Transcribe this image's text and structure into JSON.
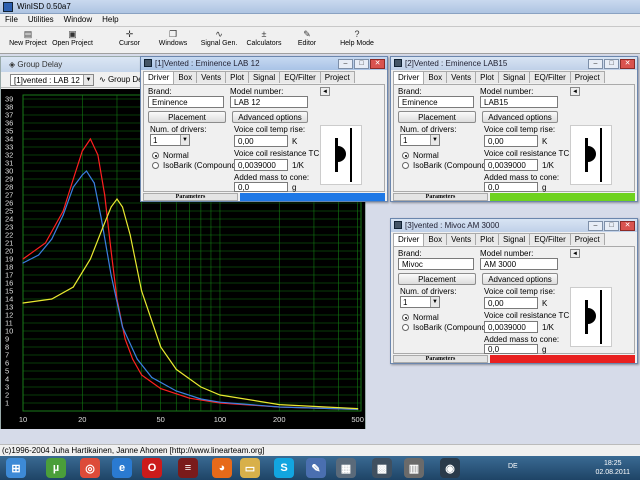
{
  "window": {
    "title": "WinISD 0.50a7"
  },
  "menu": [
    "File",
    "Utilities",
    "Window",
    "Help"
  ],
  "toolbar": [
    {
      "label": "New Project",
      "icon": "new-project-icon",
      "glyph": "▤"
    },
    {
      "label": "Open Project",
      "icon": "open-folder-icon",
      "glyph": "▣"
    },
    {
      "label": "Cursor",
      "icon": "cursor-icon",
      "glyph": "✛"
    },
    {
      "label": "Windows",
      "icon": "windows-icon",
      "glyph": "❐"
    },
    {
      "label": "Signal Gen.",
      "icon": "signal-generator-icon",
      "glyph": "∿"
    },
    {
      "label": "Calculators",
      "icon": "calculator-icon",
      "glyph": "±"
    },
    {
      "label": "Editor",
      "icon": "editor-icon",
      "glyph": "✎"
    },
    {
      "label": "Help Mode",
      "icon": "help-icon",
      "glyph": "?"
    }
  ],
  "group_delay": {
    "title": "Group Delay",
    "selector": "[1]vented : LAB 12",
    "button": "Group De"
  },
  "chart_data": {
    "type": "line",
    "title": "Group Delay",
    "x_scale": "log",
    "xlim": [
      10,
      520
    ],
    "ylim": [
      0,
      39.5
    ],
    "x_ticks": [
      10,
      20,
      50,
      100,
      200,
      500
    ],
    "y_ticks": [
      1,
      2,
      3,
      4,
      5,
      6,
      7,
      8,
      9,
      10,
      11,
      12,
      13,
      14,
      15,
      16,
      17,
      18,
      19,
      20,
      21,
      22,
      23,
      24,
      25,
      26,
      27,
      28,
      29,
      30,
      31,
      32,
      33,
      34,
      35,
      36,
      37,
      38,
      39
    ],
    "grid": true,
    "series": [
      {
        "color": "#ff2020",
        "x": [
          10,
          13,
          16,
          18,
          20,
          22,
          24,
          26,
          28,
          30,
          33,
          36,
          40,
          50,
          70,
          100,
          200,
          500
        ],
        "y": [
          19,
          21,
          25,
          29,
          32.5,
          34,
          32,
          27,
          20,
          14,
          9,
          6.5,
          4.5,
          2.8,
          1.6,
          1.0,
          0.5,
          0.2
        ]
      },
      {
        "color": "#3a7fe0",
        "x": [
          10,
          12,
          14,
          16,
          18,
          20,
          21,
          23,
          25,
          28,
          32,
          38,
          45,
          60,
          80,
          100,
          200,
          500
        ],
        "y": [
          18.5,
          19.5,
          21.5,
          24.5,
          28,
          29.5,
          30,
          28.5,
          24,
          17,
          10.5,
          6.5,
          4.2,
          2.5,
          1.5,
          1.1,
          0.5,
          0.2
        ]
      },
      {
        "color": "#e8e830",
        "x": [
          10,
          14,
          18,
          22,
          25,
          28,
          30,
          32,
          35,
          40,
          50,
          60,
          80,
          100,
          200,
          500
        ],
        "y": [
          13.5,
          14,
          15.5,
          19,
          22.5,
          25.5,
          26.5,
          25.5,
          22,
          15,
          8,
          5.2,
          3,
          2,
          0.8,
          0.3
        ]
      }
    ]
  },
  "windows": [
    {
      "title": "[1]Vented : Eminence  LAB 12",
      "tabs": [
        "Driver",
        "Box",
        "Vents",
        "Plot",
        "Signal",
        "EQ/Filter",
        "Project"
      ],
      "brand_label": "Brand:",
      "brand": "Eminence",
      "model_label": "Model number:",
      "model": "LAB 12",
      "placement": "Placement",
      "advanced": "Advanced options",
      "num_label": "Num. of drivers:",
      "num": "1",
      "normal": "Normal",
      "isobarik": "IsoBarik (Compound)",
      "vc_rise_label": "Voice coil temp rise:",
      "vc_rise": "0,00",
      "vc_rise_unit": "K",
      "vc_tc_label": "Voice coil resistance TC:",
      "vc_tc": "0,0039000",
      "vc_tc_unit": "1/K",
      "mass_label": "Added mass to cone:",
      "mass": "0,0",
      "mass_unit": "g",
      "params": "Parameters",
      "status_color": "#1e78e6"
    },
    {
      "title": "[2]Vented : Eminence LAB15",
      "tabs": [
        "Driver",
        "Box",
        "Vents",
        "Plot",
        "Signal",
        "EQ/Filter",
        "Project"
      ],
      "brand_label": "Brand:",
      "brand": "Eminence",
      "model_label": "Model number:",
      "model": "LAB15",
      "placement": "Placement",
      "advanced": "Advanced options",
      "num_label": "Num. of drivers:",
      "num": "1",
      "normal": "Normal",
      "isobarik": "IsoBarik (Compound)",
      "vc_rise_label": "Voice coil temp rise:",
      "vc_rise": "0,00",
      "vc_rise_unit": "K",
      "vc_tc_label": "Voice coil resistance TC:",
      "vc_tc": "0,0039000",
      "vc_tc_unit": "1/K",
      "mass_label": "Added mass to cone:",
      "mass": "0,0",
      "mass_unit": "g",
      "params": "Parameters",
      "status_color": "#6ed21e"
    },
    {
      "title": "[3]vented : Mivoc AM 3000",
      "tabs": [
        "Driver",
        "Box",
        "Vents",
        "Plot",
        "Signal",
        "EQ/Filter",
        "Project"
      ],
      "brand_label": "Brand:",
      "brand": "Mivoc",
      "model_label": "Model number:",
      "model": "AM 3000",
      "placement": "Placement",
      "advanced": "Advanced options",
      "num_label": "Num. of drivers:",
      "num": "1",
      "normal": "Normal",
      "isobarik": "IsoBarik (Compound)",
      "vc_rise_label": "Voice coil temp rise:",
      "vc_rise": "0,00",
      "vc_rise_unit": "K",
      "vc_tc_label": "Voice coil resistance TC:",
      "vc_tc": "0,0039000",
      "vc_tc_unit": "1/K",
      "mass_label": "Added mass to cone:",
      "mass": "0,0",
      "mass_unit": "g",
      "params": "Parameters",
      "status_color": "#e82020"
    }
  ],
  "statusbar": "(c)1996-2004 Juha Hartikainen, Janne Ahonen [http://www.linearteam.org]",
  "taskbar": {
    "lang": "DE",
    "time": "18:25",
    "date": "02.08.2011",
    "apps": [
      {
        "icon": "start-orb-icon",
        "color": "#3d8ad6",
        "glyph": "⊞"
      },
      {
        "icon": "utorrent-icon",
        "color": "#4a9e3a",
        "glyph": "µ"
      },
      {
        "icon": "chrome-icon",
        "color": "#dd4b39",
        "glyph": "◎"
      },
      {
        "icon": "internet-explorer-icon",
        "color": "#2a7ad1",
        "glyph": "e"
      },
      {
        "icon": "opera-icon",
        "color": "#cc1b1b",
        "glyph": "O"
      },
      {
        "icon": "media-app-icon",
        "color": "#7a1b1b",
        "glyph": "≡"
      },
      {
        "icon": "firefox-icon",
        "color": "#e76a1a",
        "glyph": "◕"
      },
      {
        "icon": "folder-icon",
        "color": "#d8b04a",
        "glyph": "▭"
      },
      {
        "icon": "skype-icon",
        "color": "#12a5e0",
        "glyph": "S"
      },
      {
        "icon": "paint-icon",
        "color": "#4a6fb0",
        "glyph": "✎"
      },
      {
        "icon": "winisd-icon",
        "color": "#5a6a7a",
        "glyph": "▦"
      },
      {
        "icon": "device-manager-icon",
        "color": "#405060",
        "glyph": "▩"
      },
      {
        "icon": "film-icon",
        "color": "#6a6a6a",
        "glyph": "▥"
      },
      {
        "icon": "media-player-icon",
        "color": "#2a3a4a",
        "glyph": "◉"
      }
    ]
  }
}
